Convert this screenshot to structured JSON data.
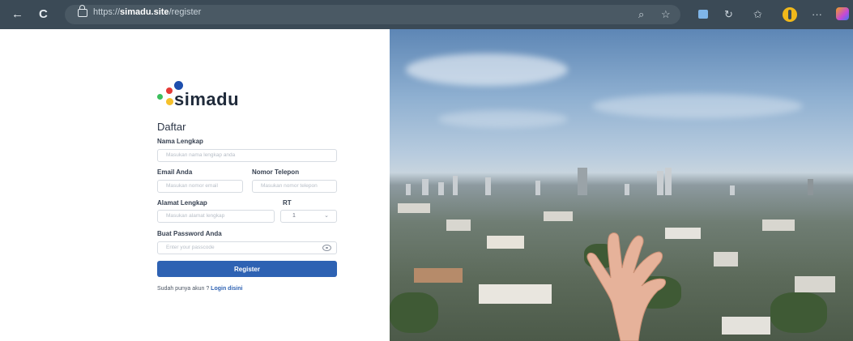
{
  "browser": {
    "url_prefix": "https://",
    "url_host": "simadu.site",
    "url_path": "/register",
    "back_glyph": "←",
    "reload_glyph": "C"
  },
  "brand": {
    "name": "simadu",
    "colors": {
      "red": "#e53935",
      "blue": "#1e4fae",
      "yellow": "#f6c12b",
      "green": "#3bbf5c"
    }
  },
  "form": {
    "title": "Daftar",
    "full_name": {
      "label": "Nama Lengkap",
      "placeholder": "Masukan nama lengkap anda"
    },
    "email": {
      "label": "Email Anda",
      "placeholder": "Masukan nomor email"
    },
    "phone": {
      "label": "Nomor Telepon",
      "placeholder": "Masukan nomor telepon"
    },
    "address": {
      "label": "Alamat Lengkap",
      "placeholder": "Masukan alamat lengkap"
    },
    "rt": {
      "label": "RT",
      "value": "1"
    },
    "password": {
      "label": "Buat Password Anda",
      "placeholder": "Enter your passcode"
    },
    "submit_label": "Register",
    "footer_text": "Sudah punya akun ? ",
    "footer_link": "Login disini"
  },
  "colors": {
    "primary": "#2e62b3",
    "toolbar": "#3b4a56"
  },
  "icons": [
    "back-icon",
    "reload-icon",
    "lock-icon",
    "zoom-icon",
    "favorite-star-icon",
    "app-tile-icon",
    "refresh-extension-icon",
    "favorites-icon",
    "profile-icon",
    "more-icon",
    "copilot-icon",
    "eye-icon",
    "chevron-down-icon"
  ]
}
